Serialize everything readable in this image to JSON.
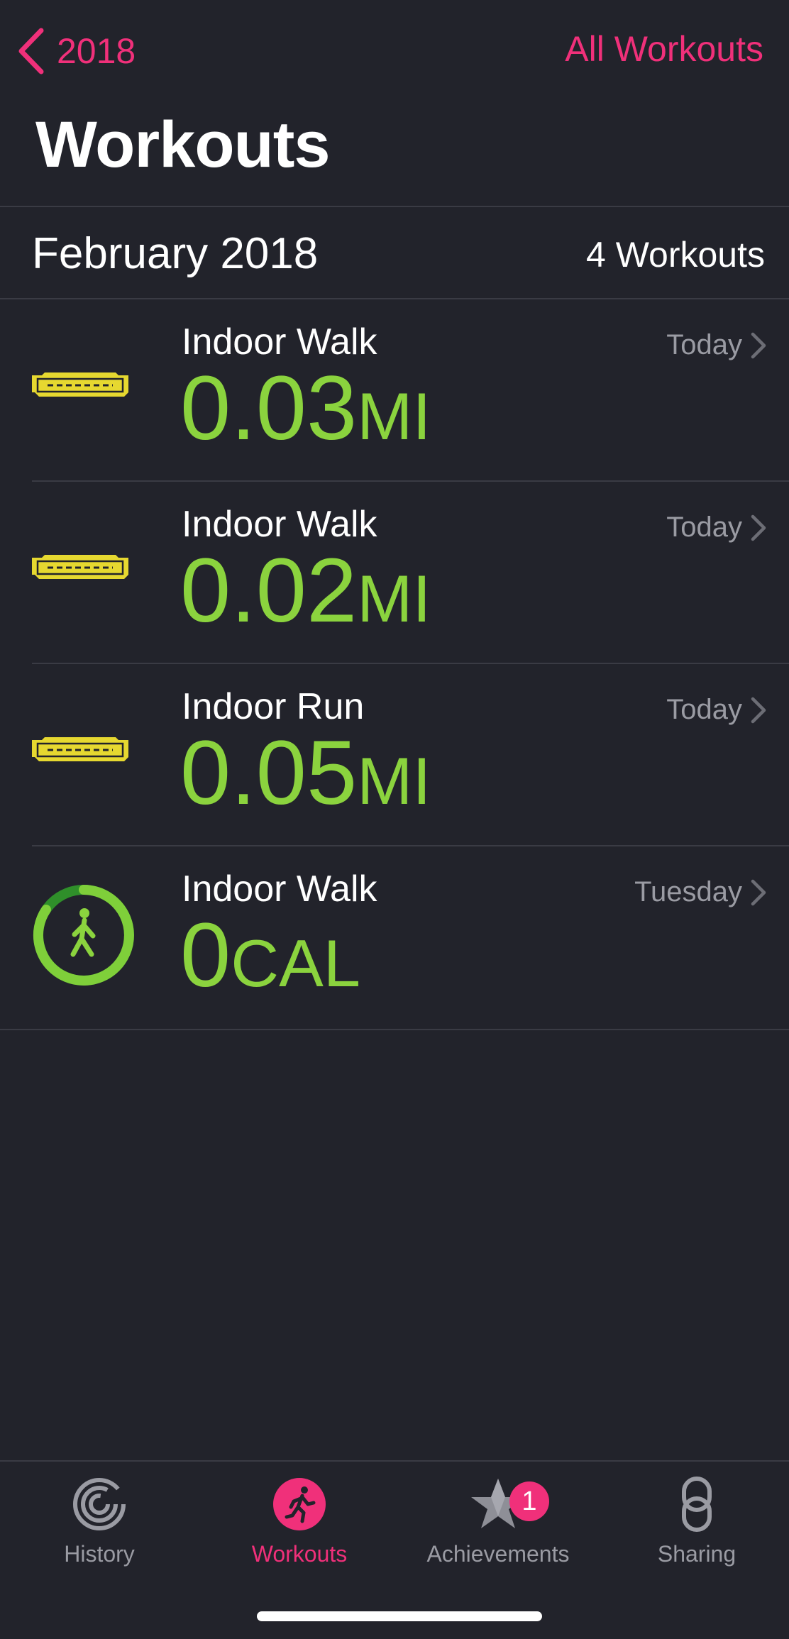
{
  "nav": {
    "back_label": "2018",
    "right_label": "All Workouts"
  },
  "page_title": "Workouts",
  "section": {
    "month": "February 2018",
    "count": "4 Workouts"
  },
  "workouts": [
    {
      "name": "Indoor Walk",
      "value": "0.03",
      "unit": "MI",
      "date": "Today",
      "icon": "technogym-logo"
    },
    {
      "name": "Indoor Walk",
      "value": "0.02",
      "unit": "MI",
      "date": "Today",
      "icon": "technogym-logo"
    },
    {
      "name": "Indoor Run",
      "value": "0.05",
      "unit": "MI",
      "date": "Today",
      "icon": "technogym-logo"
    },
    {
      "name": "Indoor Walk",
      "value": "0",
      "unit": "CAL",
      "date": "Tuesday",
      "icon": "walking-ring-icon"
    }
  ],
  "tabs": [
    {
      "label": "History",
      "icon": "history-rings-icon",
      "active": false
    },
    {
      "label": "Workouts",
      "icon": "running-figure-icon",
      "active": true
    },
    {
      "label": "Achievements",
      "icon": "star-icon",
      "active": false,
      "badge": "1"
    },
    {
      "label": "Sharing",
      "icon": "sharing-icon",
      "active": false
    }
  ],
  "colors": {
    "accent": "#f0307a",
    "metric": "#8bd33e",
    "background": "#22232b",
    "secondary_text": "#9a9ba3",
    "logo": "#e6d830"
  }
}
